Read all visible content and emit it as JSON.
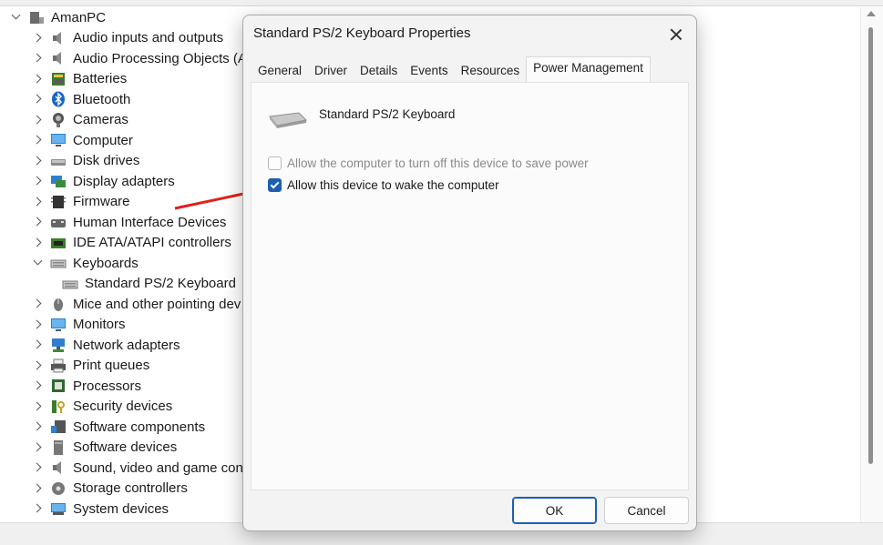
{
  "tree": {
    "root": "AmanPC",
    "items": [
      {
        "label": "Audio inputs and outputs",
        "icon": "speaker-icon"
      },
      {
        "label": "Audio Processing Objects (AP",
        "icon": "speaker-icon"
      },
      {
        "label": "Batteries",
        "icon": "battery-icon"
      },
      {
        "label": "Bluetooth",
        "icon": "bluetooth-icon"
      },
      {
        "label": "Cameras",
        "icon": "camera-icon"
      },
      {
        "label": "Computer",
        "icon": "monitor-icon"
      },
      {
        "label": "Disk drives",
        "icon": "disk-icon"
      },
      {
        "label": "Display adapters",
        "icon": "display-adapter-icon"
      },
      {
        "label": "Firmware",
        "icon": "firmware-icon"
      },
      {
        "label": "Human Interface Devices",
        "icon": "hid-icon"
      },
      {
        "label": "IDE ATA/ATAPI controllers",
        "icon": "ide-icon"
      },
      {
        "label": "Keyboards",
        "icon": "keyboard-icon",
        "expanded": true
      },
      {
        "label": "Standard PS/2 Keyboard",
        "icon": "keyboard-icon",
        "child": true
      },
      {
        "label": "Mice and other pointing dev",
        "icon": "mouse-icon"
      },
      {
        "label": "Monitors",
        "icon": "monitor-icon"
      },
      {
        "label": "Network adapters",
        "icon": "network-icon"
      },
      {
        "label": "Print queues",
        "icon": "printer-icon"
      },
      {
        "label": "Processors",
        "icon": "processor-icon"
      },
      {
        "label": "Security devices",
        "icon": "security-icon"
      },
      {
        "label": "Software components",
        "icon": "software-icon"
      },
      {
        "label": "Software devices",
        "icon": "software-device-icon"
      },
      {
        "label": "Sound, video and game cont",
        "icon": "speaker-icon"
      },
      {
        "label": "Storage controllers",
        "icon": "storage-icon"
      },
      {
        "label": "System devices",
        "icon": "system-icon"
      }
    ]
  },
  "dialog": {
    "title": "Standard PS/2 Keyboard Properties",
    "tabs": [
      "General",
      "Driver",
      "Details",
      "Events",
      "Resources",
      "Power Management"
    ],
    "active_tab": "Power Management",
    "device_name": "Standard PS/2 Keyboard",
    "option_turn_off": {
      "label": "Allow the computer to turn off this device to save power",
      "checked": false,
      "enabled": false
    },
    "option_wake": {
      "label": "Allow this device to wake the computer",
      "checked": true,
      "enabled": true
    },
    "ok_label": "OK",
    "cancel_label": "Cancel"
  },
  "colors": {
    "accent": "#1b5fb3",
    "annotation_arrow": "#e02020"
  }
}
